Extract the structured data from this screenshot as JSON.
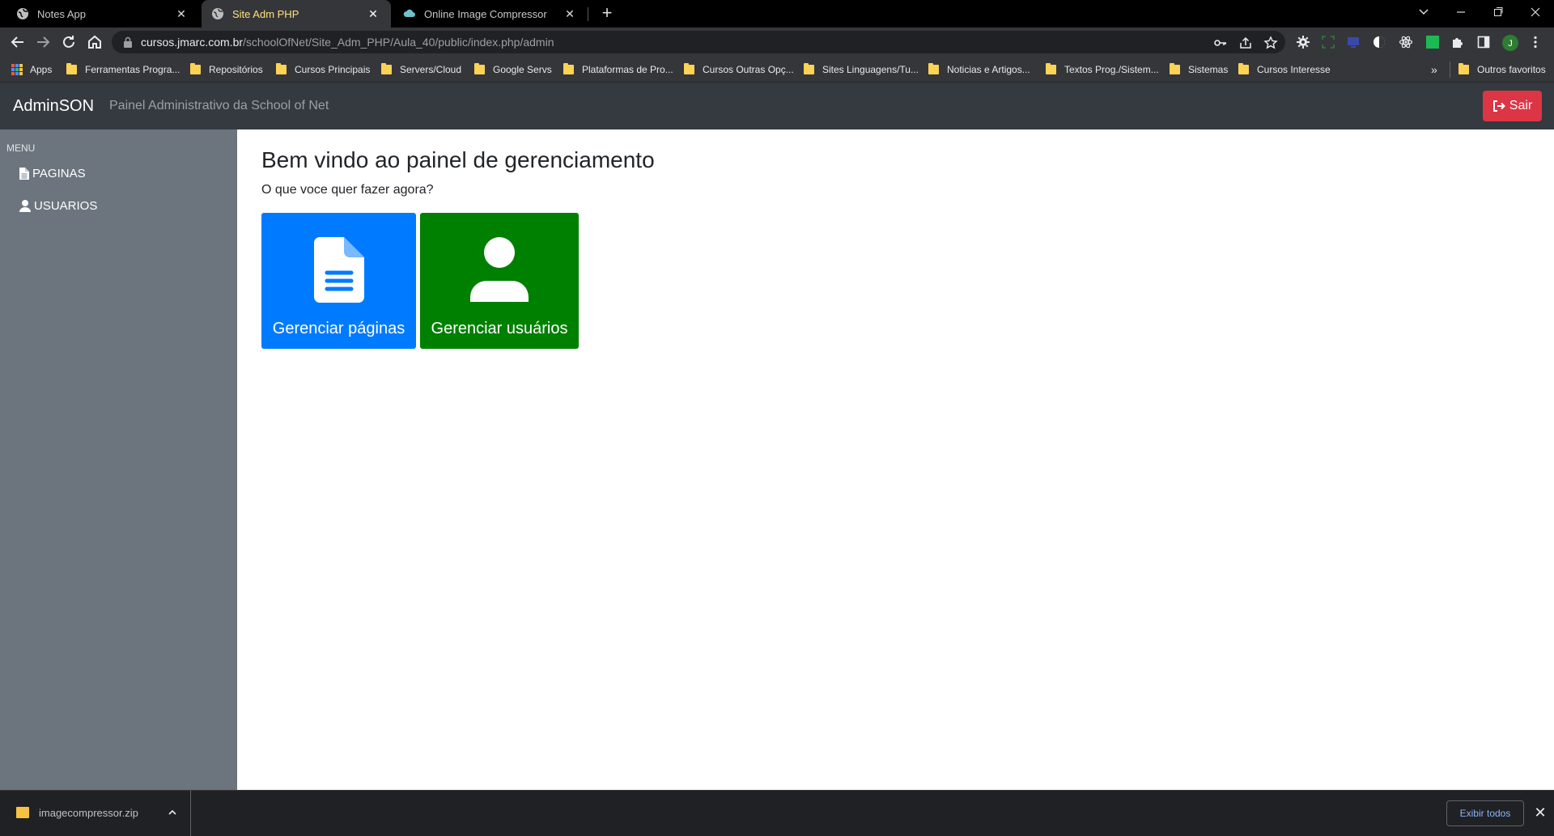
{
  "browser": {
    "tabs": [
      {
        "title": "Notes App",
        "active": false
      },
      {
        "title": "Site Adm PHP",
        "active": true
      },
      {
        "title": "Online Image Compressor",
        "active": false
      }
    ],
    "url": {
      "host": "cursos.jmarc.com.br",
      "path": "/schoolOfNet/Site_Adm_PHP/Aula_40/public/index.php/admin"
    },
    "profile_initial": "J",
    "bookmarks": [
      "Apps",
      "Ferramentas Progra...",
      "Repositórios",
      "Cursos Principais",
      "Servers/Cloud",
      "Google Servs",
      "Plataformas de Pro...",
      "Cursos Outras Opç...",
      "Sites Linguagens/Tu...",
      "Noticias e Artigos...",
      "Textos Prog./Sistem...",
      "Sistemas",
      "Cursos Interesse"
    ],
    "bookmarks_overflow": "»",
    "other_bookmarks": "Outros favoritos"
  },
  "header": {
    "brand": "AdminSON",
    "subtitle": "Painel Administrativo da School of Net",
    "logout_label": "Sair"
  },
  "sidebar": {
    "menu_label": "MENU",
    "items": [
      {
        "label": "PAGINAS",
        "icon": "file-icon"
      },
      {
        "label": "USUARIOS",
        "icon": "user-icon"
      }
    ]
  },
  "main": {
    "title": "Bem vindo ao painel de gerenciamento",
    "subtitle": "O que voce quer fazer agora?",
    "tiles": [
      {
        "label": "Gerenciar páginas",
        "icon": "document-icon",
        "color": "#007bff"
      },
      {
        "label": "Gerenciar usuários",
        "icon": "user-icon",
        "color": "#008000"
      }
    ]
  },
  "downloads": {
    "file_name": "imagecompressor.zip",
    "show_all_label": "Exibir todos"
  },
  "colors": {
    "header_bg": "#343a40",
    "sidebar_bg": "#6c757d",
    "logout_btn": "#dc3545"
  }
}
